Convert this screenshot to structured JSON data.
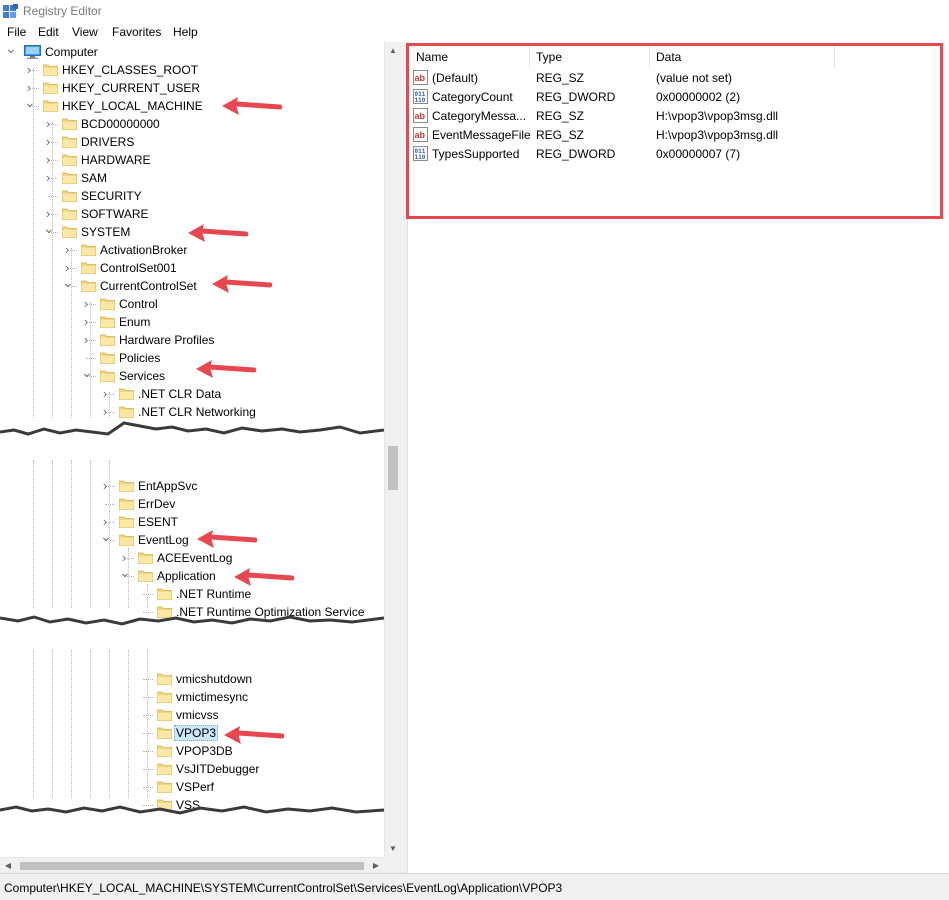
{
  "window": {
    "title": "Registry Editor"
  },
  "menu": [
    "File",
    "Edit",
    "View",
    "Favorites",
    "Help"
  ],
  "tree": {
    "segment1": [
      {
        "label": "Computer",
        "icon": "computer-icon",
        "expanded": true
      },
      {
        "label": "HKEY_CLASSES_ROOT",
        "icon": "folder-icon",
        "expanded": false
      },
      {
        "label": "HKEY_CURRENT_USER",
        "icon": "folder-icon",
        "expanded": false
      },
      {
        "label": "HKEY_LOCAL_MACHINE",
        "icon": "folder-icon",
        "expanded": true
      },
      {
        "label": "BCD00000000",
        "icon": "folder-icon",
        "expanded": false
      },
      {
        "label": "DRIVERS",
        "icon": "folder-icon",
        "expanded": false
      },
      {
        "label": "HARDWARE",
        "icon": "folder-icon",
        "expanded": false
      },
      {
        "label": "SAM",
        "icon": "folder-icon",
        "expanded": false
      },
      {
        "label": "SECURITY",
        "icon": "folder-icon",
        "expanded": null
      },
      {
        "label": "SOFTWARE",
        "icon": "folder-icon",
        "expanded": false
      },
      {
        "label": "SYSTEM",
        "icon": "folder-icon",
        "expanded": true
      },
      {
        "label": "ActivationBroker",
        "icon": "folder-icon",
        "expanded": false
      },
      {
        "label": "ControlSet001",
        "icon": "folder-icon",
        "expanded": false
      },
      {
        "label": "CurrentControlSet",
        "icon": "folder-icon",
        "expanded": true
      },
      {
        "label": "Control",
        "icon": "folder-icon",
        "expanded": false
      },
      {
        "label": "Enum",
        "icon": "folder-icon",
        "expanded": false
      },
      {
        "label": "Hardware Profiles",
        "icon": "folder-icon",
        "expanded": false
      },
      {
        "label": "Policies",
        "icon": "folder-icon",
        "expanded": null
      },
      {
        "label": "Services",
        "icon": "folder-icon",
        "expanded": true
      },
      {
        "label": ".NET CLR Data",
        "icon": "folder-icon",
        "expanded": false
      },
      {
        "label": ".NET CLR Networking",
        "icon": "folder-icon",
        "expanded": false
      }
    ],
    "segment2": [
      {
        "label": "EntAppSvc",
        "icon": "folder-icon",
        "expanded": false
      },
      {
        "label": "ErrDev",
        "icon": "folder-icon",
        "expanded": null
      },
      {
        "label": "ESENT",
        "icon": "folder-icon",
        "expanded": false
      },
      {
        "label": "EventLog",
        "icon": "folder-icon",
        "expanded": true
      },
      {
        "label": "ACEEventLog",
        "icon": "folder-icon",
        "expanded": false
      },
      {
        "label": "Application",
        "icon": "folder-icon",
        "expanded": true
      },
      {
        "label": ".NET Runtime",
        "icon": "folder-icon",
        "expanded": null
      },
      {
        "label": ".NET Runtime Optimization Service",
        "icon": "folder-icon",
        "expanded": null
      }
    ],
    "segment3": [
      {
        "label": "vmicshutdown",
        "icon": "folder-icon",
        "expanded": null
      },
      {
        "label": "vmictimesync",
        "icon": "folder-icon",
        "expanded": null
      },
      {
        "label": "vmicvss",
        "icon": "folder-icon",
        "expanded": null
      },
      {
        "label": "VPOP3",
        "icon": "folder-icon",
        "expanded": null,
        "selected": true
      },
      {
        "label": "VPOP3DB",
        "icon": "folder-icon",
        "expanded": null
      },
      {
        "label": "VsJITDebugger",
        "icon": "folder-icon",
        "expanded": null
      },
      {
        "label": "VSPerf",
        "icon": "folder-icon",
        "expanded": null
      },
      {
        "label": "VSS",
        "icon": "folder-icon",
        "expanded": null
      }
    ]
  },
  "values": {
    "columns": [
      "Name",
      "Type",
      "Data"
    ],
    "rows": [
      {
        "name": "(Default)",
        "type": "REG_SZ",
        "data": "(value not set)",
        "icon": "string-value-icon"
      },
      {
        "name": "CategoryCount",
        "type": "REG_DWORD",
        "data": "0x00000002 (2)",
        "icon": "binary-value-icon"
      },
      {
        "name": "CategoryMessa...",
        "type": "REG_SZ",
        "data": "H:\\vpop3\\vpop3msg.dll",
        "icon": "string-value-icon"
      },
      {
        "name": "EventMessageFile",
        "type": "REG_SZ",
        "data": "H:\\vpop3\\vpop3msg.dll",
        "icon": "string-value-icon"
      },
      {
        "name": "TypesSupported",
        "type": "REG_DWORD",
        "data": "0x00000007 (7)",
        "icon": "binary-value-icon"
      }
    ]
  },
  "status": {
    "path": "Computer\\HKEY_LOCAL_MACHINE\\SYSTEM\\CurrentControlSet\\Services\\EventLog\\Application\\VPOP3"
  },
  "colors": {
    "annotation": "#e8474f",
    "folder": "#f5d680",
    "selection": "#cce8ff",
    "statusbar": "#f0f0f0"
  }
}
